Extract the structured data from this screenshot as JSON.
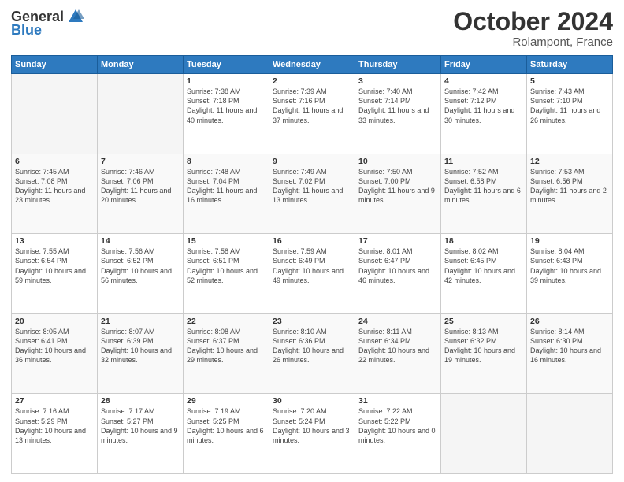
{
  "header": {
    "logo_general": "General",
    "logo_blue": "Blue",
    "month": "October 2024",
    "location": "Rolampont, France"
  },
  "days_of_week": [
    "Sunday",
    "Monday",
    "Tuesday",
    "Wednesday",
    "Thursday",
    "Friday",
    "Saturday"
  ],
  "weeks": [
    [
      {
        "day": "",
        "sunrise": "",
        "sunset": "",
        "daylight": ""
      },
      {
        "day": "",
        "sunrise": "",
        "sunset": "",
        "daylight": ""
      },
      {
        "day": "1",
        "sunrise": "Sunrise: 7:38 AM",
        "sunset": "Sunset: 7:18 PM",
        "daylight": "Daylight: 11 hours and 40 minutes."
      },
      {
        "day": "2",
        "sunrise": "Sunrise: 7:39 AM",
        "sunset": "Sunset: 7:16 PM",
        "daylight": "Daylight: 11 hours and 37 minutes."
      },
      {
        "day": "3",
        "sunrise": "Sunrise: 7:40 AM",
        "sunset": "Sunset: 7:14 PM",
        "daylight": "Daylight: 11 hours and 33 minutes."
      },
      {
        "day": "4",
        "sunrise": "Sunrise: 7:42 AM",
        "sunset": "Sunset: 7:12 PM",
        "daylight": "Daylight: 11 hours and 30 minutes."
      },
      {
        "day": "5",
        "sunrise": "Sunrise: 7:43 AM",
        "sunset": "Sunset: 7:10 PM",
        "daylight": "Daylight: 11 hours and 26 minutes."
      }
    ],
    [
      {
        "day": "6",
        "sunrise": "Sunrise: 7:45 AM",
        "sunset": "Sunset: 7:08 PM",
        "daylight": "Daylight: 11 hours and 23 minutes."
      },
      {
        "day": "7",
        "sunrise": "Sunrise: 7:46 AM",
        "sunset": "Sunset: 7:06 PM",
        "daylight": "Daylight: 11 hours and 20 minutes."
      },
      {
        "day": "8",
        "sunrise": "Sunrise: 7:48 AM",
        "sunset": "Sunset: 7:04 PM",
        "daylight": "Daylight: 11 hours and 16 minutes."
      },
      {
        "day": "9",
        "sunrise": "Sunrise: 7:49 AM",
        "sunset": "Sunset: 7:02 PM",
        "daylight": "Daylight: 11 hours and 13 minutes."
      },
      {
        "day": "10",
        "sunrise": "Sunrise: 7:50 AM",
        "sunset": "Sunset: 7:00 PM",
        "daylight": "Daylight: 11 hours and 9 minutes."
      },
      {
        "day": "11",
        "sunrise": "Sunrise: 7:52 AM",
        "sunset": "Sunset: 6:58 PM",
        "daylight": "Daylight: 11 hours and 6 minutes."
      },
      {
        "day": "12",
        "sunrise": "Sunrise: 7:53 AM",
        "sunset": "Sunset: 6:56 PM",
        "daylight": "Daylight: 11 hours and 2 minutes."
      }
    ],
    [
      {
        "day": "13",
        "sunrise": "Sunrise: 7:55 AM",
        "sunset": "Sunset: 6:54 PM",
        "daylight": "Daylight: 10 hours and 59 minutes."
      },
      {
        "day": "14",
        "sunrise": "Sunrise: 7:56 AM",
        "sunset": "Sunset: 6:52 PM",
        "daylight": "Daylight: 10 hours and 56 minutes."
      },
      {
        "day": "15",
        "sunrise": "Sunrise: 7:58 AM",
        "sunset": "Sunset: 6:51 PM",
        "daylight": "Daylight: 10 hours and 52 minutes."
      },
      {
        "day": "16",
        "sunrise": "Sunrise: 7:59 AM",
        "sunset": "Sunset: 6:49 PM",
        "daylight": "Daylight: 10 hours and 49 minutes."
      },
      {
        "day": "17",
        "sunrise": "Sunrise: 8:01 AM",
        "sunset": "Sunset: 6:47 PM",
        "daylight": "Daylight: 10 hours and 46 minutes."
      },
      {
        "day": "18",
        "sunrise": "Sunrise: 8:02 AM",
        "sunset": "Sunset: 6:45 PM",
        "daylight": "Daylight: 10 hours and 42 minutes."
      },
      {
        "day": "19",
        "sunrise": "Sunrise: 8:04 AM",
        "sunset": "Sunset: 6:43 PM",
        "daylight": "Daylight: 10 hours and 39 minutes."
      }
    ],
    [
      {
        "day": "20",
        "sunrise": "Sunrise: 8:05 AM",
        "sunset": "Sunset: 6:41 PM",
        "daylight": "Daylight: 10 hours and 36 minutes."
      },
      {
        "day": "21",
        "sunrise": "Sunrise: 8:07 AM",
        "sunset": "Sunset: 6:39 PM",
        "daylight": "Daylight: 10 hours and 32 minutes."
      },
      {
        "day": "22",
        "sunrise": "Sunrise: 8:08 AM",
        "sunset": "Sunset: 6:37 PM",
        "daylight": "Daylight: 10 hours and 29 minutes."
      },
      {
        "day": "23",
        "sunrise": "Sunrise: 8:10 AM",
        "sunset": "Sunset: 6:36 PM",
        "daylight": "Daylight: 10 hours and 26 minutes."
      },
      {
        "day": "24",
        "sunrise": "Sunrise: 8:11 AM",
        "sunset": "Sunset: 6:34 PM",
        "daylight": "Daylight: 10 hours and 22 minutes."
      },
      {
        "day": "25",
        "sunrise": "Sunrise: 8:13 AM",
        "sunset": "Sunset: 6:32 PM",
        "daylight": "Daylight: 10 hours and 19 minutes."
      },
      {
        "day": "26",
        "sunrise": "Sunrise: 8:14 AM",
        "sunset": "Sunset: 6:30 PM",
        "daylight": "Daylight: 10 hours and 16 minutes."
      }
    ],
    [
      {
        "day": "27",
        "sunrise": "Sunrise: 7:16 AM",
        "sunset": "Sunset: 5:29 PM",
        "daylight": "Daylight: 10 hours and 13 minutes."
      },
      {
        "day": "28",
        "sunrise": "Sunrise: 7:17 AM",
        "sunset": "Sunset: 5:27 PM",
        "daylight": "Daylight: 10 hours and 9 minutes."
      },
      {
        "day": "29",
        "sunrise": "Sunrise: 7:19 AM",
        "sunset": "Sunset: 5:25 PM",
        "daylight": "Daylight: 10 hours and 6 minutes."
      },
      {
        "day": "30",
        "sunrise": "Sunrise: 7:20 AM",
        "sunset": "Sunset: 5:24 PM",
        "daylight": "Daylight: 10 hours and 3 minutes."
      },
      {
        "day": "31",
        "sunrise": "Sunrise: 7:22 AM",
        "sunset": "Sunset: 5:22 PM",
        "daylight": "Daylight: 10 hours and 0 minutes."
      },
      {
        "day": "",
        "sunrise": "",
        "sunset": "",
        "daylight": ""
      },
      {
        "day": "",
        "sunrise": "",
        "sunset": "",
        "daylight": ""
      }
    ]
  ]
}
